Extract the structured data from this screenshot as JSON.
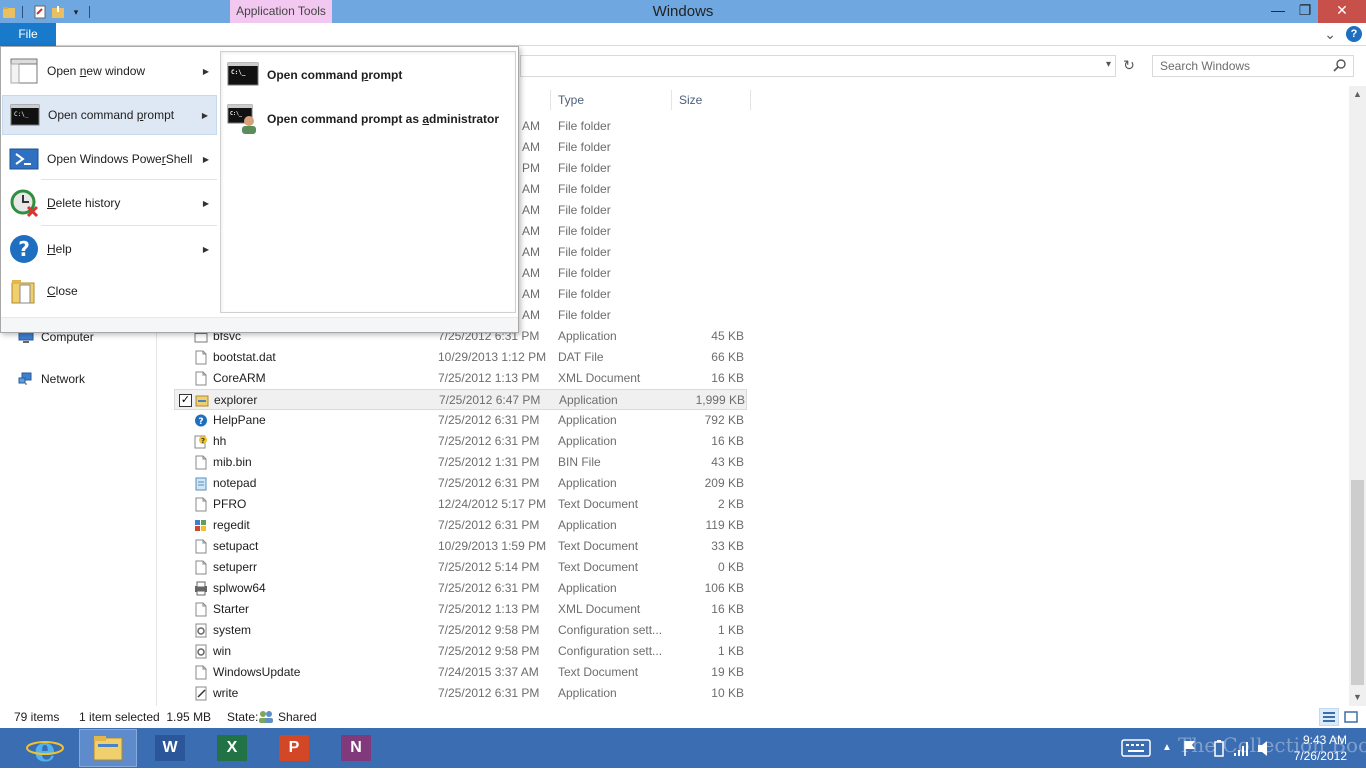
{
  "titlebar": {
    "title": "Windows",
    "contextual_tab": "Application Tools",
    "minimize_glyph": "—",
    "maximize_glyph": "❐",
    "close_glyph": "✕"
  },
  "ribbon": {
    "file_tab": "File",
    "help_glyph": "?",
    "expand_glyph": "⌄"
  },
  "address": {
    "refresh_glyph": "↻",
    "dropdown_glyph": "▾",
    "search_placeholder": "Search Windows"
  },
  "nav": {
    "items": [
      {
        "label": "Computer"
      },
      {
        "label": "Network"
      }
    ]
  },
  "columns": {
    "type": "Type",
    "size": "Size"
  },
  "folder_rows": [
    {
      "date": "AM",
      "type": "File folder"
    },
    {
      "date": "AM",
      "type": "File folder"
    },
    {
      "date": "PM",
      "type": "File folder"
    },
    {
      "date": "AM",
      "type": "File folder"
    },
    {
      "date": "AM",
      "type": "File folder"
    },
    {
      "date": "AM",
      "type": "File folder"
    },
    {
      "date": "AM",
      "type": "File folder"
    },
    {
      "date": "AM",
      "type": "File folder"
    },
    {
      "date": "AM",
      "type": "File folder"
    },
    {
      "date": "AM",
      "type": "File folder"
    }
  ],
  "files": [
    {
      "name": "bfsvc",
      "date": "7/25/2012 6:31 PM",
      "type": "Application",
      "size": "45 KB",
      "icon": "app-icon"
    },
    {
      "name": "bootstat.dat",
      "date": "10/29/2013 1:12 PM",
      "type": "DAT File",
      "size": "66 KB",
      "icon": "file-icon"
    },
    {
      "name": "CoreARM",
      "date": "7/25/2012 1:13 PM",
      "type": "XML Document",
      "size": "16 KB",
      "icon": "file-icon"
    },
    {
      "name": "explorer",
      "date": "7/25/2012 6:47 PM",
      "type": "Application",
      "size": "1,999 KB",
      "icon": "explorer-icon",
      "selected": true
    },
    {
      "name": "HelpPane",
      "date": "7/25/2012 6:31 PM",
      "type": "Application",
      "size": "792 KB",
      "icon": "help-icon"
    },
    {
      "name": "hh",
      "date": "7/25/2012 6:31 PM",
      "type": "Application",
      "size": "16 KB",
      "icon": "hh-icon"
    },
    {
      "name": "mib.bin",
      "date": "7/25/2012 1:31 PM",
      "type": "BIN File",
      "size": "43 KB",
      "icon": "file-icon"
    },
    {
      "name": "notepad",
      "date": "7/25/2012 6:31 PM",
      "type": "Application",
      "size": "209 KB",
      "icon": "notepad-icon"
    },
    {
      "name": "PFRO",
      "date": "12/24/2012 5:17 PM",
      "type": "Text Document",
      "size": "2 KB",
      "icon": "file-icon"
    },
    {
      "name": "regedit",
      "date": "7/25/2012 6:31 PM",
      "type": "Application",
      "size": "119 KB",
      "icon": "regedit-icon"
    },
    {
      "name": "setupact",
      "date": "10/29/2013 1:59 PM",
      "type": "Text Document",
      "size": "33 KB",
      "icon": "file-icon"
    },
    {
      "name": "setuperr",
      "date": "7/25/2012 5:14 PM",
      "type": "Text Document",
      "size": "0 KB",
      "icon": "file-icon"
    },
    {
      "name": "splwow64",
      "date": "7/25/2012 6:31 PM",
      "type": "Application",
      "size": "106 KB",
      "icon": "printer-icon"
    },
    {
      "name": "Starter",
      "date": "7/25/2012 1:13 PM",
      "type": "XML Document",
      "size": "16 KB",
      "icon": "file-icon"
    },
    {
      "name": "system",
      "date": "7/25/2012 9:58 PM",
      "type": "Configuration sett...",
      "size": "1 KB",
      "icon": "config-icon"
    },
    {
      "name": "win",
      "date": "7/25/2012 9:58 PM",
      "type": "Configuration sett...",
      "size": "1 KB",
      "icon": "config-icon"
    },
    {
      "name": "WindowsUpdate",
      "date": "7/24/2015 3:37 AM",
      "type": "Text Document",
      "size": "19 KB",
      "icon": "file-icon"
    },
    {
      "name": "write",
      "date": "7/25/2012 6:31 PM",
      "type": "Application",
      "size": "10 KB",
      "icon": "write-icon"
    }
  ],
  "checkbox_glyph": "✓",
  "status": {
    "count": "79 items",
    "selection": "1 item selected  1.95 MB",
    "state_label": "State:",
    "state_value": "Shared"
  },
  "file_menu": {
    "items": [
      {
        "label_pre": "Open ",
        "label_u": "n",
        "label_post": "ew window",
        "icon": "window-icon"
      },
      {
        "label_pre": "Open command ",
        "label_u": "p",
        "label_post": "rompt",
        "icon": "cmd-icon"
      },
      {
        "label_pre": "Open Windows Powe",
        "label_u": "r",
        "label_post": "Shell",
        "icon": "powershell-icon"
      },
      {
        "label_pre": "",
        "label_u": "D",
        "label_post": "elete history",
        "icon": "delete-history-icon"
      },
      {
        "label_pre": "",
        "label_u": "H",
        "label_post": "elp",
        "icon": "help-icon"
      },
      {
        "label_pre": "",
        "label_u": "C",
        "label_post": "lose",
        "icon": "close-folder-icon"
      }
    ],
    "arrow_glyph": "▶",
    "submenu": [
      {
        "label_pre": "Open command ",
        "label_u": "p",
        "label_post": "rompt"
      },
      {
        "label_pre": "Open command prompt as ",
        "label_u": "a",
        "label_post": "dministrator"
      }
    ]
  },
  "taskbar": {
    "word_letter": "W",
    "excel_letter": "X",
    "powerpoint_letter": "P",
    "onenote_letter": "N",
    "clock_time": "9:43 AM",
    "clock_date": "7/26/2012",
    "watermark": "The Collection Book",
    "colors": {
      "taskbar": "#3b6db2",
      "word": "#2b579a",
      "excel": "#217346",
      "powerpoint": "#d24726",
      "onenote": "#80397b"
    }
  }
}
